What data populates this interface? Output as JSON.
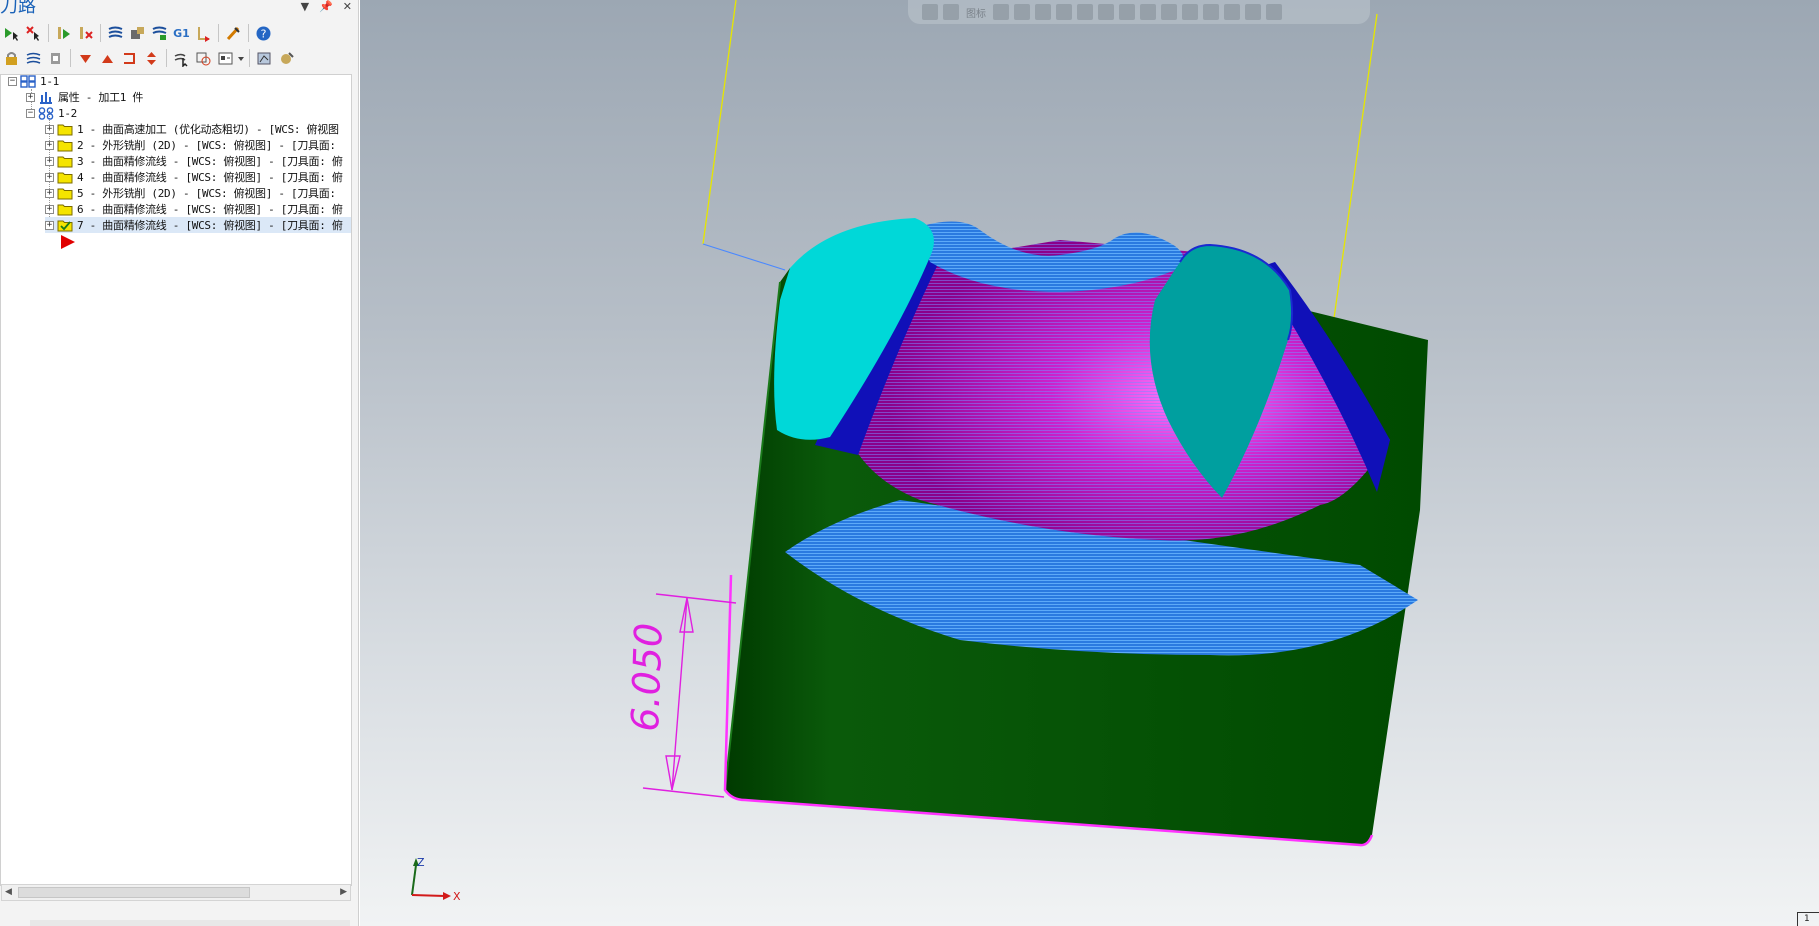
{
  "panel": {
    "title": "刀路",
    "controls": {
      "dropdown": "▼",
      "pin": "📌",
      "close": "✕"
    }
  },
  "toolbar": {
    "g1_label": "G1"
  },
  "tree": {
    "root": "1-1",
    "properties": "属性 - 加工1 件",
    "group": "1-2",
    "operations": [
      "1 - 曲面高速加工 (优化动态粗切) - [WCS: 俯视图",
      "2 - 外形铣削 (2D) - [WCS: 俯视图] - [刀具面: ",
      "3 - 曲面精修流线 - [WCS: 俯视图] - [刀具面: 俯",
      "4 - 曲面精修流线 - [WCS: 俯视图] - [刀具面: 俯",
      "5 - 外形铣削 (2D) - [WCS: 俯视图] - [刀具面: ",
      "6 - 曲面精修流线 - [WCS: 俯视图] - [刀具面: 俯",
      "7 - 曲面精修流线 - [WCS: 俯视图] - [刀具面: 俯"
    ]
  },
  "viewport": {
    "toolbar_label": "图标",
    "dimension": "6.050",
    "axis_z": "Z",
    "axis_x": "X",
    "corner": "1"
  },
  "colors": {
    "panel_title": "#1a62b8",
    "dimension": "#e020e0",
    "body_green": "#004a00",
    "cyan_face": "#00d8d8",
    "teal_face": "#00a0a0",
    "magenta": "#c010c0",
    "toolpath_blue": "#1e7fff",
    "boundary_yellow": "#e6e600"
  }
}
